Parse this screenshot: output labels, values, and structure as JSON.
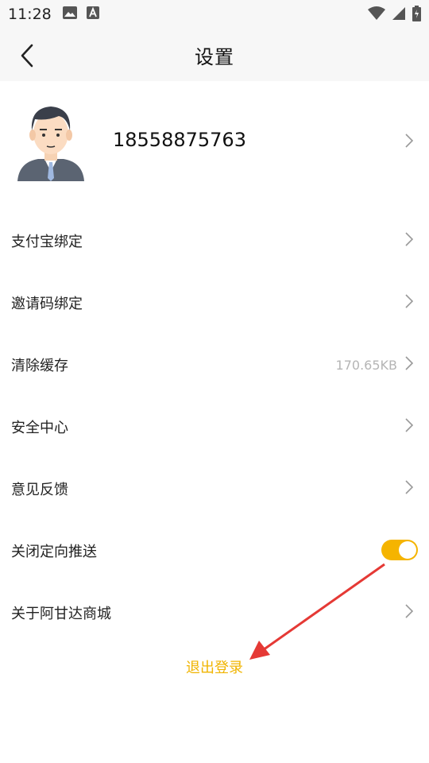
{
  "status_bar": {
    "time": "11:28"
  },
  "header": {
    "title": "设置"
  },
  "profile": {
    "phone": "18558875763"
  },
  "menu": {
    "items": [
      {
        "label": "支付宝绑定"
      },
      {
        "label": "邀请码绑定"
      },
      {
        "label": "清除缓存",
        "value": "170.65KB"
      },
      {
        "label": "安全中心"
      },
      {
        "label": "意见反馈"
      },
      {
        "label": "关闭定向推送",
        "toggle_on": true
      },
      {
        "label": "关于阿甘达商城"
      }
    ]
  },
  "logout": {
    "label": "退出登录"
  },
  "colors": {
    "accent": "#f5b400",
    "logout_text": "#f0b400",
    "annotation_arrow": "#e53935"
  }
}
